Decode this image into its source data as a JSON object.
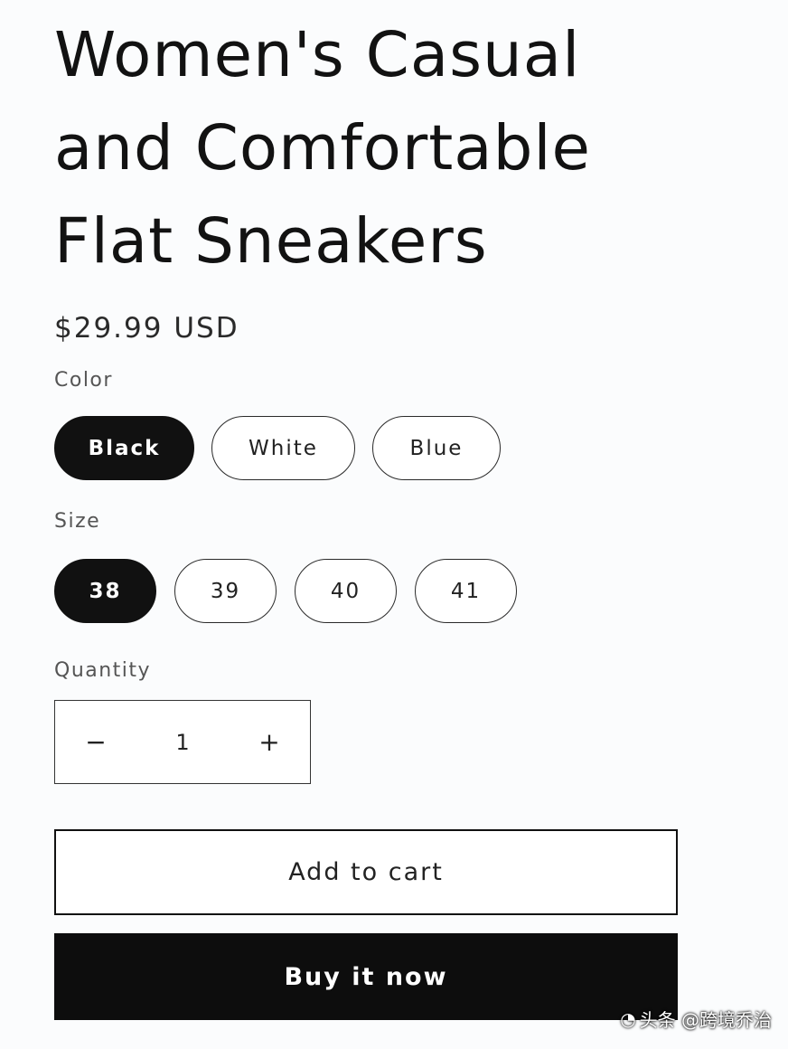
{
  "product": {
    "title": "Women's Casual and Comfortable Flat Sneakers",
    "price": "$29.99 USD"
  },
  "color": {
    "label": "Color",
    "options": [
      "Black",
      "White",
      "Blue"
    ],
    "selected": "Black"
  },
  "size": {
    "label": "Size",
    "options": [
      "38",
      "39",
      "40",
      "41"
    ],
    "selected": "38"
  },
  "quantity": {
    "label": "Quantity",
    "value": "1",
    "decrement_symbol": "−",
    "increment_symbol": "+"
  },
  "actions": {
    "add_to_cart": "Add to cart",
    "buy_now": "Buy it now"
  },
  "watermark": {
    "text": "头条 @跨境乔治",
    "icon": "camera-icon"
  },
  "colors": {
    "primary": "#111111",
    "background": "#fbfcfd"
  }
}
